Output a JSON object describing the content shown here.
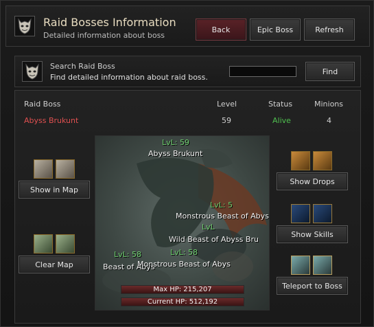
{
  "header": {
    "title": "Raid Bosses Information",
    "subtitle": "Detailed information about boss",
    "back_label": "Back",
    "epic_label": "Epic Boss",
    "refresh_label": "Refresh"
  },
  "search": {
    "title": "Search Raid Boss",
    "subtitle": "Find detailed information about raid boss.",
    "input_value": "",
    "find_label": "Find"
  },
  "table": {
    "headers": [
      "Raid Boss",
      "Level",
      "Status",
      "Minions"
    ],
    "row": {
      "name": "Abyss Brukunt",
      "level": "59",
      "status": "Alive",
      "minions": "4"
    }
  },
  "actions": {
    "show_in_map": "Show in Map",
    "clear_map": "Clear Map",
    "show_drops": "Show Drops",
    "show_skills": "Show Skills",
    "teleport": "Teleport to Boss"
  },
  "scene": {
    "labels": [
      "LvL: 59",
      "Abyss Brukunt",
      "LvL: 5",
      "Monstrous Beast of Abys",
      "LvL",
      "Wild Beast of Abyss Bru",
      "LvL: 58",
      "LvL: 58",
      "Beast of Abys",
      "Monstrous Beast of Abys"
    ],
    "max_hp": "Max HP: 215,207",
    "current_hp": "Current HP: 512,192"
  },
  "colors": {
    "boss_name": "#e05050",
    "alive": "#4fbf4f",
    "title": "#e8dcc0"
  },
  "icons": [
    "demon-mask-icon",
    "demon-mask-icon",
    "map-icon",
    "character-icon",
    "chest-icon",
    "skill-icon",
    "teleport-icon"
  ]
}
